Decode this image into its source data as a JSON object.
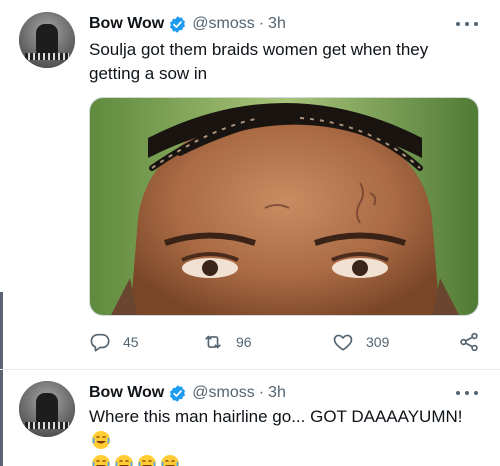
{
  "tweets": [
    {
      "author": {
        "name": "Bow Wow",
        "handle": "@smoss",
        "separator": "·",
        "time": "3h"
      },
      "text": "Soulja got them braids women get when they getting a sow in",
      "media": {
        "description_icon": "photo"
      },
      "actions": {
        "replies": "45",
        "retweets": "96",
        "likes": "309"
      }
    },
    {
      "author": {
        "name": "Bow Wow",
        "handle": "@smoss",
        "separator": "·",
        "time": "3h"
      },
      "text": "Where this man hairline go... GOT DAAAAYUMN!"
    }
  ],
  "colors": {
    "text": "#0f1419",
    "secondary": "#536471",
    "verified": "#1d9bf0",
    "border": "#e6ecf0"
  },
  "icons": [
    "verified-badge-icon",
    "more-icon",
    "reply-icon",
    "retweet-icon",
    "like-icon",
    "share-icon",
    "laughing-emoji-icon"
  ]
}
